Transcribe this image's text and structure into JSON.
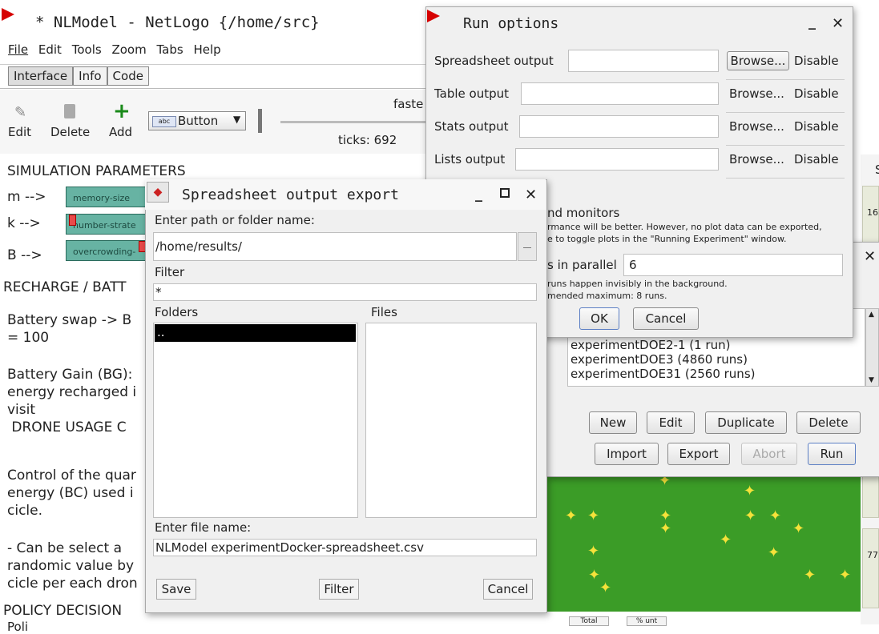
{
  "main_window": {
    "title": "* NLModel - NetLogo {/home/src}",
    "menu": [
      "File",
      "Edit",
      "Tools",
      "Zoom",
      "Tabs",
      "Help"
    ],
    "tabs": [
      "Interface",
      "Info",
      "Code"
    ],
    "toolbar": {
      "edit": "Edit",
      "delete": "Delete",
      "add": "Add",
      "widget_select": "Button",
      "speed_label": "faste",
      "ticks": "ticks: 692"
    },
    "text": {
      "sim_params": "SIMULATION PARAMETERS",
      "m_label": "m -->",
      "k_label": "k -->",
      "b_label": "B -->",
      "slider1": "memory-size",
      "slider2": "number-strate",
      "slider3": "overcrowding-",
      "recharge": "RECHARGE / BATT",
      "battery_swap": "Battery swap  -> B",
      "eq100": "= 100",
      "battery_gain": "Battery Gain (BG):",
      "energy_recharged": "energy recharged i",
      "visit": "visit",
      "drone_usage": " DRONE USAGE C",
      "control": "Control of the quar",
      "energy_bc": "energy (BC) used i",
      "cicle": "cicle.",
      "can_be": "- Can be select a",
      "randomic": "randomic value by",
      "cicle_per": "cicle per each dron",
      "policy": "POLICY DECISION",
      "poli": "Poli"
    },
    "right_edge": {
      "label_top": "S",
      "num1": "16",
      "num2": "77",
      "btn1": "Total",
      "btn2": "% unt"
    }
  },
  "run_options": {
    "title": "Run options",
    "rows": [
      {
        "label": "Spreadsheet output",
        "browse": "Browse...",
        "disable": "Disable"
      },
      {
        "label": "Table output",
        "browse": "Browse...",
        "disable": "Disable"
      },
      {
        "label": "Stats output",
        "browse": "Browse...",
        "disable": "Disable"
      },
      {
        "label": "Lists output",
        "browse": "Browse...",
        "disable": "Disable"
      }
    ],
    "monitors_text": "nd monitors",
    "perf_note1": "rmance will be better. However, no plot data can be exported,",
    "perf_note2": "e to toggle plots in the \"Running Experiment\" window.",
    "parallel_label": "s in parallel",
    "parallel_value": "6",
    "parallel_note1": "runs happen invisibly in the background.",
    "parallel_note2": "mended maximum: 8 runs.",
    "ok": "OK",
    "cancel": "Cancel"
  },
  "experiments": {
    "items": [
      "experimentDOE2-1 (1 run)",
      "experimentDOE3 (4860 runs)",
      "experimentDOE31 (2560 runs)"
    ],
    "buttons": [
      "New",
      "Edit",
      "Duplicate",
      "Delete",
      "Import",
      "Export",
      "Abort",
      "Run"
    ]
  },
  "export_dialog": {
    "title": "Spreadsheet output export",
    "path_label": "Enter path or folder name:",
    "path_value": "/home/results/",
    "filter_label": "Filter",
    "filter_value": "*",
    "folders_label": "Folders",
    "files_label": "Files",
    "folder_items": [
      ".."
    ],
    "file_name_label": "Enter file name:",
    "file_name_value": "NLModel experimentDocker-spreadsheet.csv",
    "save": "Save",
    "filter_btn": "Filter",
    "cancel": "Cancel"
  },
  "colors": {
    "accent_red": "#d60000",
    "world_green": "#3b9c27",
    "slider_green": "#67b3a3",
    "bug_yellow": "#f5e23a"
  }
}
